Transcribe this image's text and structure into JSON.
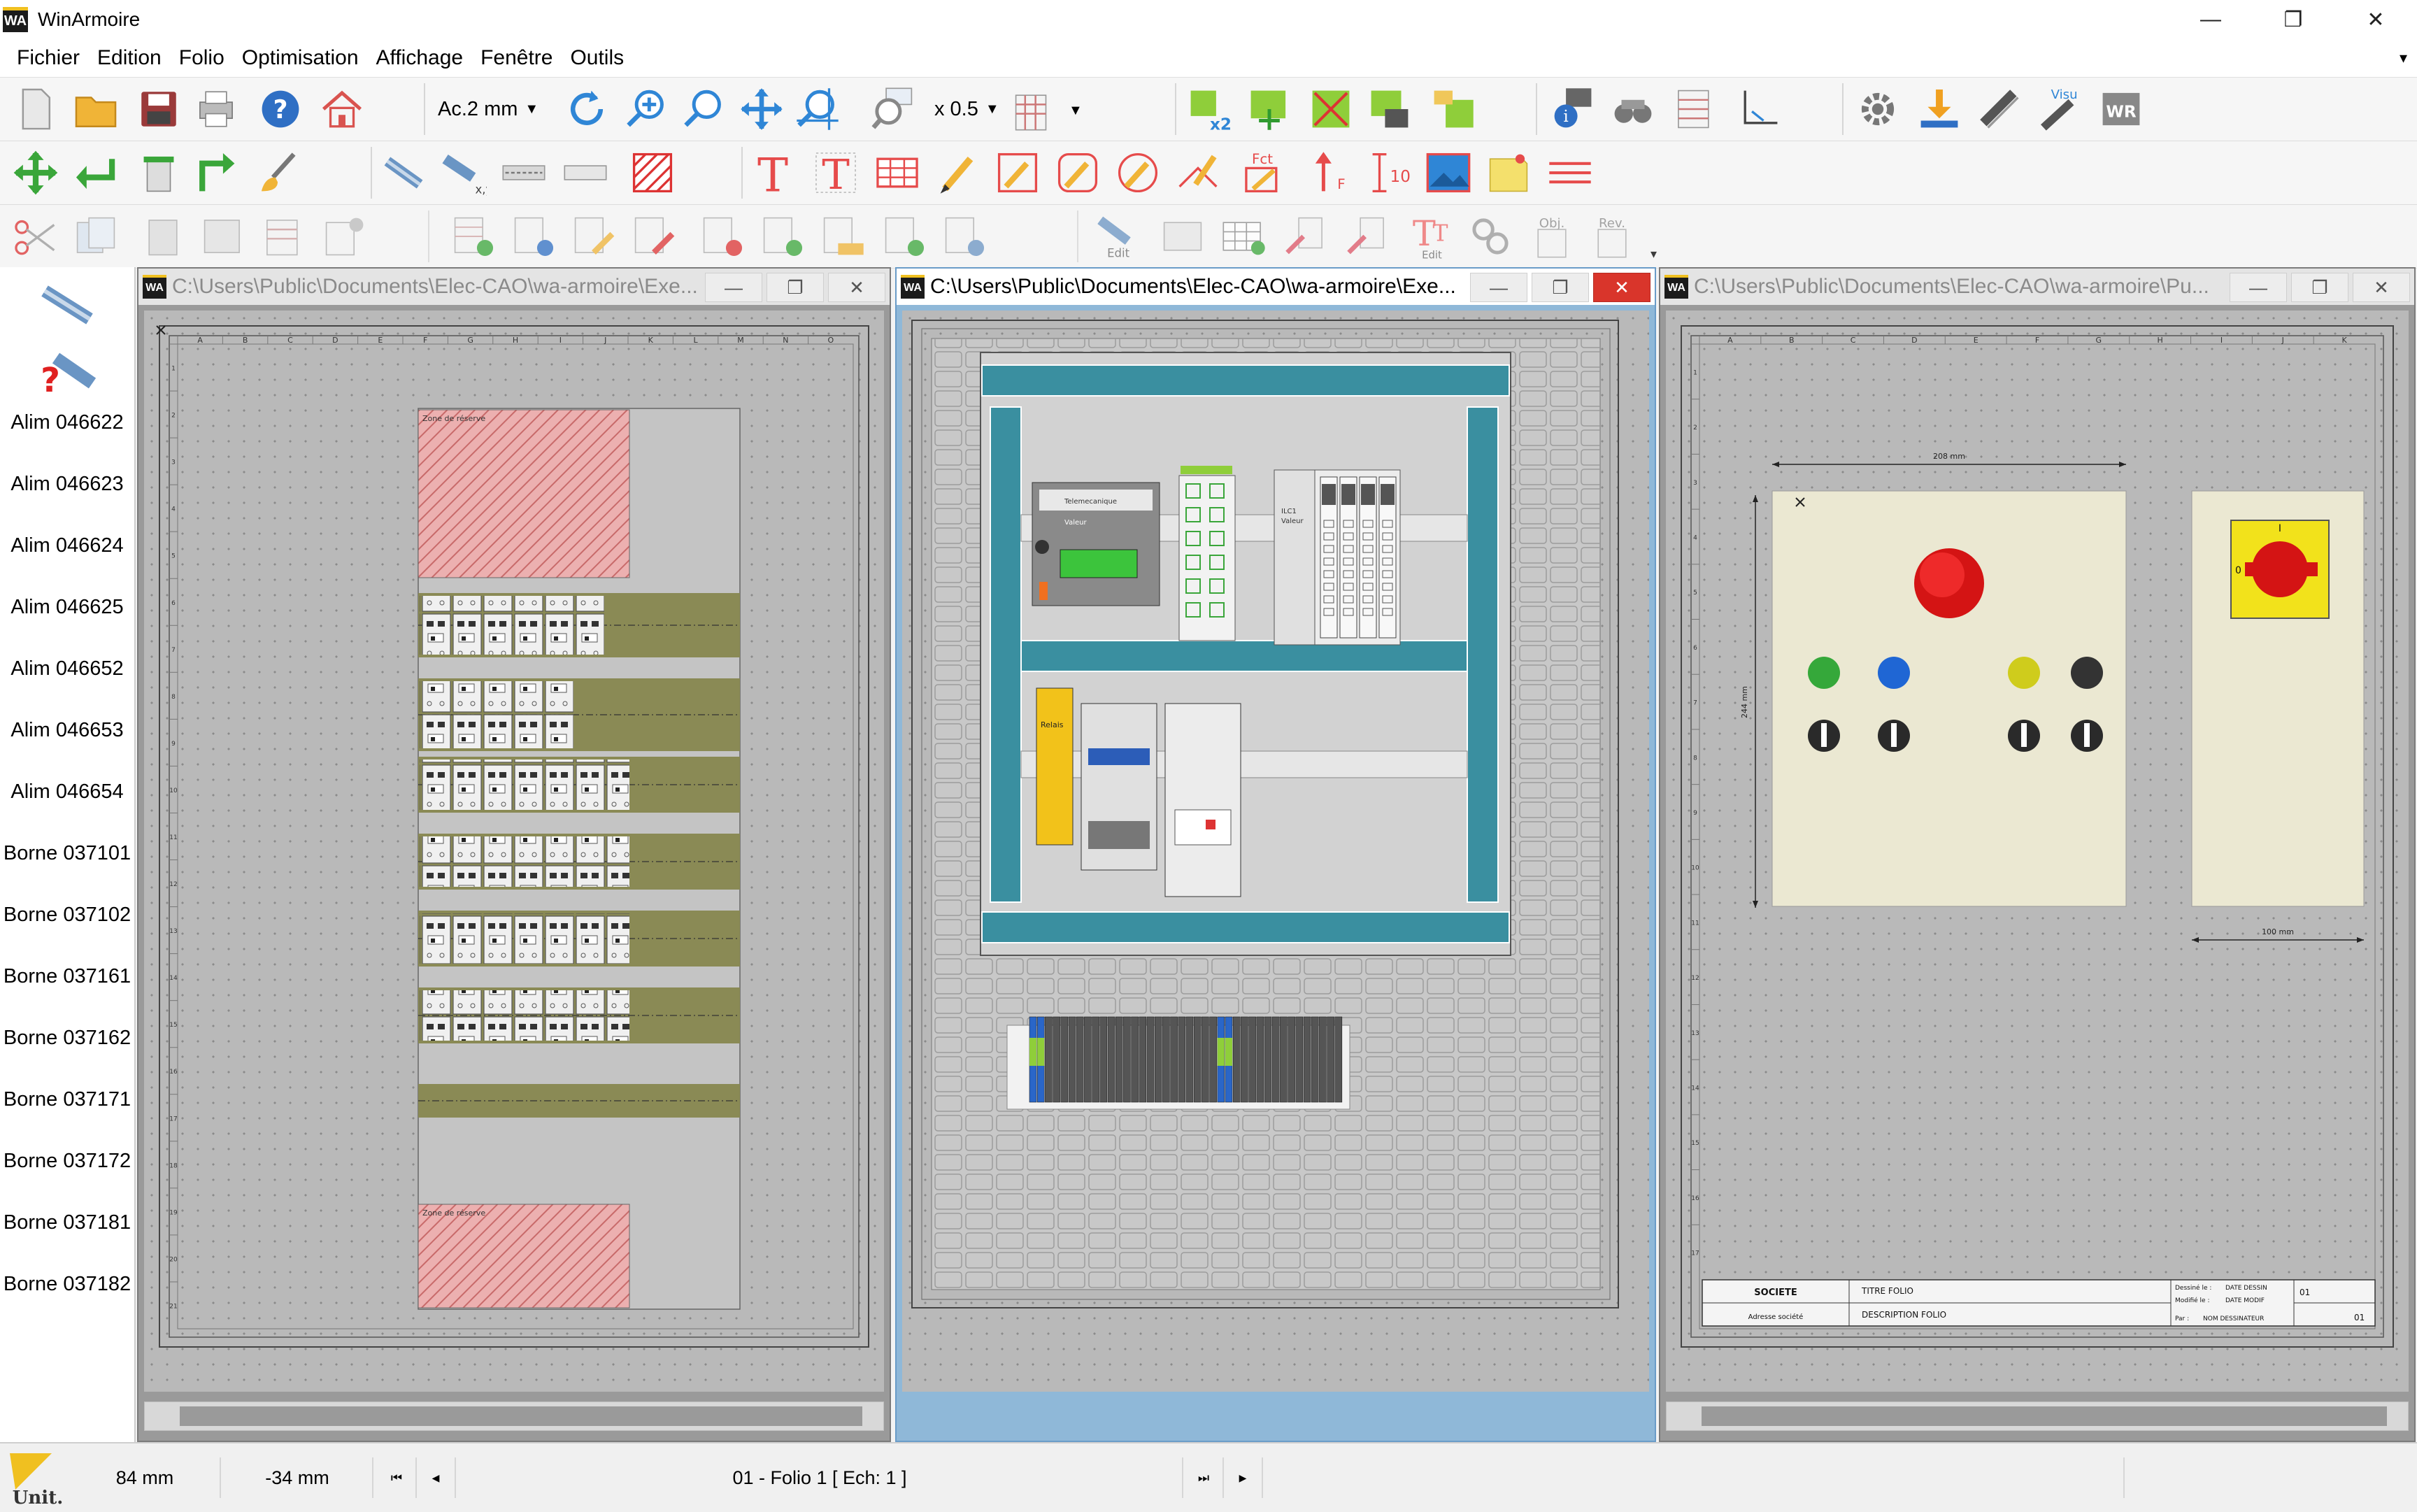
{
  "app": {
    "title": "WinArmoire",
    "logo_text": "WA"
  },
  "window_controls": {
    "minimize": "—",
    "restore": "❐",
    "close": "✕"
  },
  "menu": [
    "Fichier",
    "Edition",
    "Folio",
    "Optimisation",
    "Affichage",
    "Fenêtre",
    "Outils"
  ],
  "toolbar": {
    "pitch_value": "Ac.2 mm",
    "zoom_value": "x 0.5",
    "x2_label": "x2",
    "visu_label": "Visu",
    "edit_label": "Edit",
    "fct_label": "Fct",
    "ten_label": "10",
    "obj_label": "Obj.",
    "rev_label": "Rev."
  },
  "left_panel": {
    "items": [
      "Alim 046622",
      "Alim 046623",
      "Alim 046624",
      "Alim 046625",
      "Alim 046652",
      "Alim 046653",
      "Alim 046654",
      "Borne 037101",
      "Borne 037102",
      "Borne 037161",
      "Borne 037162",
      "Borne 037171",
      "Borne 037172",
      "Borne 037181",
      "Borne 037182"
    ]
  },
  "windows": [
    {
      "path": "C:\\Users\\Public\\Documents\\Elec-CAO\\wa-armoire\\Exe...",
      "active": false
    },
    {
      "path": "C:\\Users\\Public\\Documents\\Elec-CAO\\wa-armoire\\Exe...",
      "active": true
    },
    {
      "path": "C:\\Users\\Public\\Documents\\Elec-CAO\\wa-armoire\\Pu...",
      "active": false
    }
  ],
  "folio1": {
    "columns": [
      "A",
      "B",
      "C",
      "D",
      "E",
      "F",
      "G",
      "H",
      "I",
      "J",
      "K",
      "L",
      "M",
      "N",
      "O"
    ],
    "rows": [
      "1",
      "2",
      "3",
      "4",
      "5",
      "6",
      "7",
      "8",
      "9",
      "10",
      "11",
      "12",
      "13",
      "14",
      "15",
      "16",
      "17",
      "18",
      "19",
      "20",
      "21"
    ],
    "reserve_top": "Zone de réserve",
    "reserve_bottom": "Zone de réserve"
  },
  "folio2": {
    "relay_label": "Relais",
    "device1_title": "Telemecanique",
    "device1_value": "Valeur",
    "ilc_label": "ILC1",
    "ilc_value": "Valeur"
  },
  "folio3": {
    "columns": [
      "A",
      "B",
      "C",
      "D",
      "E",
      "F",
      "G",
      "H",
      "I",
      "J",
      "K"
    ],
    "rows": [
      "1",
      "2",
      "3",
      "4",
      "5",
      "6",
      "7",
      "8",
      "9",
      "10",
      "11",
      "12",
      "13",
      "14",
      "15",
      "16",
      "17"
    ],
    "width_dim": "208 mm",
    "height_dim": "244 mm",
    "width_dim2": "100 mm",
    "switch_on": "I",
    "switch_off": "0",
    "title_block": {
      "company": "SOCIETE",
      "address": "Adresse société",
      "title": "TITRE FOLIO",
      "description": "DESCRIPTION FOLIO",
      "drawn_label": "Dessiné le :",
      "drawn_value": "DATE DESSIN",
      "modified_label": "Modifié le :",
      "modified_value": "DATE MODIF",
      "by_label": "Par :",
      "by_value": "NOM DESSINATEUR",
      "folio_no": "01",
      "folio_total": "01"
    }
  },
  "statusbar": {
    "unit_label": "Unit.",
    "x_coord": "84 mm",
    "y_coord": "-34 mm",
    "folio_info": "01 - Folio 1 [ Ech: 1 ]",
    "nav_first": "⏮",
    "nav_prev": "◀",
    "nav_next": "▶",
    "nav_last": "⏭"
  },
  "colors": {
    "teal_frame": "#3a8fa0",
    "reserve_hatch": "#e7a3a3",
    "rail_olive": "#8a8a55",
    "estop_red": "#e01b1b",
    "switch_yellow": "#f2e21b",
    "panel_beige": "#ebe8d2"
  }
}
